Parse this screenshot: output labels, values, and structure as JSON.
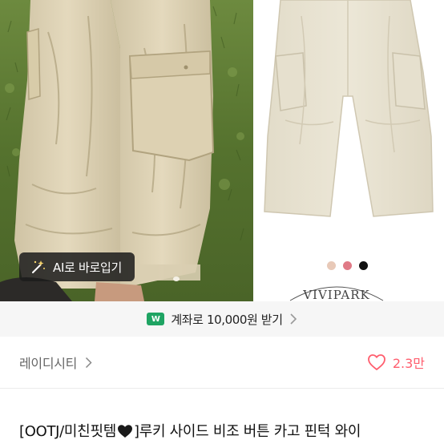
{
  "gallery": {
    "ai_button_label": "AI로 바로입기",
    "color_swatches": [
      "#e8c9b8",
      "#e07a86",
      "#111111"
    ],
    "brand": "VIVIPARK"
  },
  "coupon": {
    "icon_text": "W",
    "label": "계좌로 10,000원 받기"
  },
  "shop": {
    "name": "레이디시티",
    "like_count": "2.3만"
  },
  "product": {
    "title_prefix": "[OOTJ/미친핏템",
    "title_suffix": "]루키 사이드 비조 버튼 카고 핀턱 와이"
  },
  "colors": {
    "accent_like": "#ff5e6e",
    "coupon_green": "#1fa463"
  }
}
